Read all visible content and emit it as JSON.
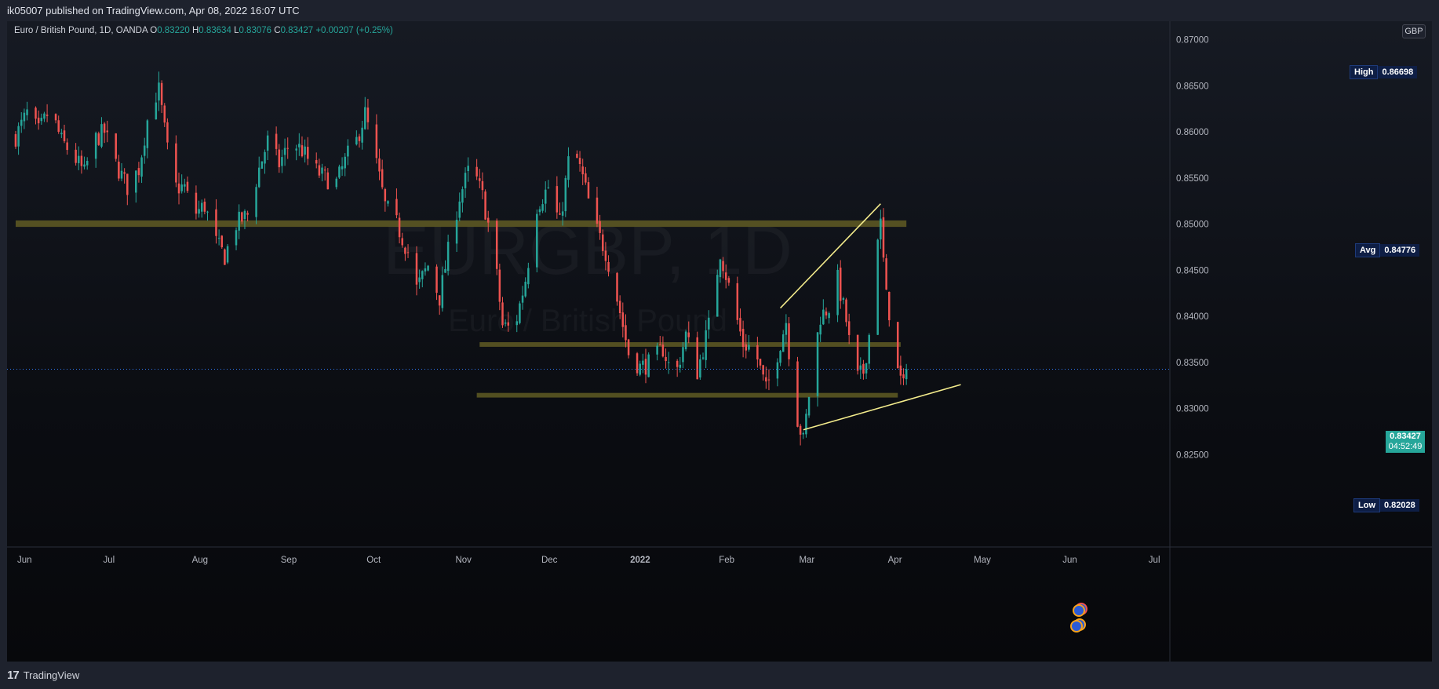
{
  "header": {
    "published_text": "ik05007 published on TradingView.com, Apr 08, 2022 16:07 UTC"
  },
  "legend": {
    "symbol": "Euro / British Pound, 1D, OANDA",
    "o_label": "O",
    "o_value": "0.83220",
    "h_label": "H",
    "h_value": "0.83634",
    "l_label": "L",
    "l_value": "0.83076",
    "c_label": "C",
    "c_value": "0.83427",
    "change": "+0.00207 (+0.25%)"
  },
  "currency_button": "GBP",
  "watermark": {
    "symbol": "EURGBP, 1D",
    "name": "Euro / British Pound"
  },
  "badges": {
    "high_label": "High",
    "high_value": "0.86698",
    "avg_label": "Avg",
    "avg_value": "0.84776",
    "low_label": "Low",
    "low_value": "0.82028"
  },
  "current_price": {
    "value": "0.83427",
    "countdown": "04:52:49"
  },
  "footer": {
    "brand": "TradingView"
  },
  "colors": {
    "up": "#26a69a",
    "down": "#ef5350",
    "zone": "#6b6526",
    "trendline": "#f4ec8c",
    "price_line": "#3179f5"
  },
  "chart_data": {
    "type": "candlestick",
    "title": "Euro / British Pound, 1D, OANDA",
    "ylim": [
      0.815,
      0.872
    ],
    "y_ticks": [
      "0.87000",
      "0.86500",
      "0.86000",
      "0.85500",
      "0.85000",
      "0.84500",
      "0.84000",
      "0.83500",
      "0.83000",
      "0.82500"
    ],
    "x_ticks": [
      {
        "label": "Jun",
        "day": 0
      },
      {
        "label": "Jul",
        "day": 30
      },
      {
        "label": "Aug",
        "day": 61
      },
      {
        "label": "Sep",
        "day": 92
      },
      {
        "label": "Oct",
        "day": 122
      },
      {
        "label": "Nov",
        "day": 153
      },
      {
        "label": "Dec",
        "day": 183
      },
      {
        "label": "2022",
        "day": 214
      },
      {
        "label": "Feb",
        "day": 245
      },
      {
        "label": "Mar",
        "day": 273
      },
      {
        "label": "Apr",
        "day": 304
      },
      {
        "label": "May",
        "day": 334
      },
      {
        "label": "Jun",
        "day": 365
      },
      {
        "label": "Jul",
        "day": 395
      }
    ],
    "x_range_days": [
      -3,
      403
    ],
    "last_day": 311,
    "close_path": [
      [
        0,
        0.8595
      ],
      [
        4,
        0.862
      ],
      [
        8,
        0.86
      ],
      [
        12,
        0.8625
      ],
      [
        16,
        0.859
      ],
      [
        20,
        0.8575
      ],
      [
        24,
        0.8555
      ],
      [
        27,
        0.859
      ],
      [
        31,
        0.86
      ],
      [
        35,
        0.8565
      ],
      [
        39,
        0.854
      ],
      [
        43,
        0.856
      ],
      [
        47,
        0.863
      ],
      [
        50,
        0.8645
      ],
      [
        53,
        0.858
      ],
      [
        56,
        0.854
      ],
      [
        59,
        0.854
      ],
      [
        62,
        0.851
      ],
      [
        66,
        0.852
      ],
      [
        70,
        0.848
      ],
      [
        73,
        0.8465
      ],
      [
        77,
        0.85
      ],
      [
        81,
        0.851
      ],
      [
        85,
        0.856
      ],
      [
        88,
        0.859
      ],
      [
        92,
        0.8565
      ],
      [
        96,
        0.859
      ],
      [
        100,
        0.858
      ],
      [
        104,
        0.856
      ],
      [
        108,
        0.855
      ],
      [
        112,
        0.8545
      ],
      [
        116,
        0.8575
      ],
      [
        119,
        0.859
      ],
      [
        122,
        0.862
      ],
      [
        126,
        0.8565
      ],
      [
        129,
        0.852
      ],
      [
        133,
        0.85
      ],
      [
        137,
        0.847
      ],
      [
        140,
        0.843
      ],
      [
        144,
        0.8455
      ],
      [
        148,
        0.842
      ],
      [
        151,
        0.847
      ],
      [
        155,
        0.853
      ],
      [
        159,
        0.8565
      ],
      [
        163,
        0.853
      ],
      [
        167,
        0.847
      ],
      [
        170,
        0.839
      ],
      [
        174,
        0.8385
      ],
      [
        178,
        0.844
      ],
      [
        182,
        0.852
      ],
      [
        186,
        0.854
      ],
      [
        190,
        0.85
      ],
      [
        194,
        0.859
      ],
      [
        198,
        0.855
      ],
      [
        202,
        0.85
      ],
      [
        206,
        0.847
      ],
      [
        210,
        0.842
      ],
      [
        214,
        0.836
      ],
      [
        218,
        0.8345
      ],
      [
        222,
        0.835
      ],
      [
        226,
        0.8365
      ],
      [
        230,
        0.833
      ],
      [
        234,
        0.838
      ],
      [
        238,
        0.834
      ],
      [
        242,
        0.839
      ],
      [
        246,
        0.847
      ],
      [
        250,
        0.842
      ],
      [
        254,
        0.837
      ],
      [
        258,
        0.8365
      ],
      [
        262,
        0.832
      ],
      [
        266,
        0.836
      ],
      [
        269,
        0.8395
      ],
      [
        272,
        0.83
      ],
      [
        275,
        0.8265
      ],
      [
        278,
        0.834
      ],
      [
        281,
        0.84
      ],
      [
        284,
        0.841
      ],
      [
        287,
        0.844
      ],
      [
        290,
        0.8395
      ],
      [
        293,
        0.833
      ],
      [
        296,
        0.834
      ],
      [
        298,
        0.838
      ],
      [
        300,
        0.848
      ],
      [
        302,
        0.85
      ],
      [
        304,
        0.842
      ],
      [
        306,
        0.839
      ],
      [
        308,
        0.834
      ],
      [
        310,
        0.8323
      ],
      [
        311,
        0.8343
      ]
    ],
    "zones": [
      {
        "from_day": 0,
        "to_day": 311,
        "top": 0.8504,
        "bottom": 0.8497
      },
      {
        "from_day": 162,
        "to_day": 309,
        "top": 0.8372,
        "bottom": 0.8367
      },
      {
        "from_day": 161,
        "to_day": 308,
        "top": 0.8317,
        "bottom": 0.8312
      }
    ],
    "trendlines": [
      {
        "x1": 267,
        "y1": 0.8409,
        "x2": 302,
        "y2": 0.8522
      },
      {
        "x1": 275,
        "y1": 0.8277,
        "x2": 330,
        "y2": 0.8326
      }
    ],
    "last_close": 0.83427
  }
}
